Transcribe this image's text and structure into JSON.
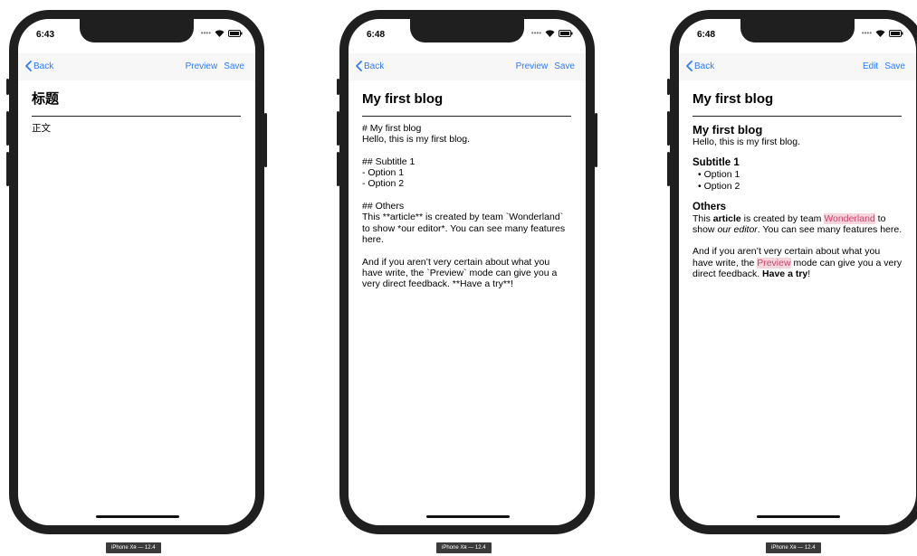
{
  "colors": {
    "accent": "#2f7cf6",
    "frame": "#1f1f1f",
    "code_bg": "#f6d6dc",
    "code_text": "#c5466e"
  },
  "phones": [
    {
      "time": "6:43",
      "nav": {
        "back": "Back",
        "right1": "Preview",
        "right2": "Save"
      },
      "title": "标题",
      "body": "正文",
      "device_label": "iPhone Xʀ — 12.4"
    },
    {
      "time": "6:48",
      "nav": {
        "back": "Back",
        "right1": "Preview",
        "right2": "Save"
      },
      "title": "My first blog",
      "body": "# My first blog\nHello, this is my first blog.\n\n## Subtitle 1\n- Option 1\n- Option 2\n\n## Others\nThis **article** is created by team `Wonderland` to show *our editor*. You can see many features here.\n\nAnd if you aren’t very certain about what you have write, the `Preview` mode can give you a very direct feedback. **Have a try**!",
      "device_label": "iPhone Xʀ — 12.4"
    },
    {
      "time": "6:48",
      "nav": {
        "back": "Back",
        "right1": "Edit",
        "right2": "Save"
      },
      "title": "My first blog",
      "preview": {
        "h1": "My first blog",
        "p1": "Hello, this is my first blog.",
        "h2a": "Subtitle 1",
        "li1": "• Option 1",
        "li2": "• Option 2",
        "h2b": "Others",
        "p2_a": "This ",
        "p2_bold": "article",
        "p2_b": " is created by team ",
        "p2_code": "Wonderland",
        "p2_c": " to show ",
        "p2_em": "our editor",
        "p2_d": ". You can see many features here.",
        "p3_a": "And if you aren’t very certain about what you have write, the ",
        "p3_code": "Preview",
        "p3_b": " mode can give you a very direct feedback. ",
        "p3_bold": "Have a try",
        "p3_c": "!"
      },
      "device_label": "iPhone Xʀ — 12.4"
    }
  ]
}
